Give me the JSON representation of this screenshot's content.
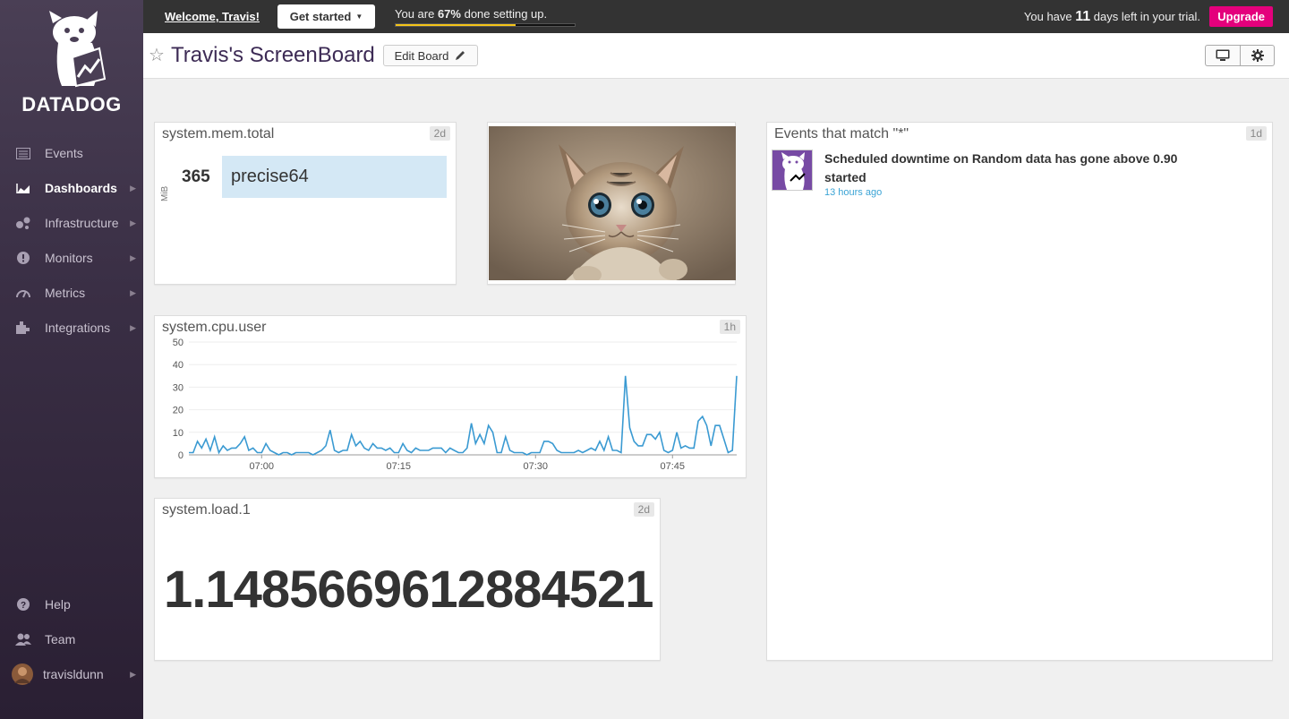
{
  "brand": {
    "name": "DATADOG"
  },
  "sidebar": {
    "items": [
      {
        "label": "Events",
        "icon": "events-icon"
      },
      {
        "label": "Dashboards",
        "icon": "dashboards-icon",
        "active": true
      },
      {
        "label": "Infrastructure",
        "icon": "infrastructure-icon"
      },
      {
        "label": "Monitors",
        "icon": "monitors-icon"
      },
      {
        "label": "Metrics",
        "icon": "metrics-icon"
      },
      {
        "label": "Integrations",
        "icon": "integrations-icon"
      }
    ],
    "bottom": [
      {
        "label": "Help",
        "icon": "help-icon"
      },
      {
        "label": "Team",
        "icon": "team-icon"
      },
      {
        "label": "travisldunn",
        "icon": "avatar"
      }
    ]
  },
  "topbar": {
    "welcome": "Welcome, Travis!",
    "get_started": "Get started",
    "progress_prefix": "You are ",
    "progress_percent": "67%",
    "progress_suffix": " done setting up.",
    "progress_value": 0.67,
    "trial_prefix": "You have ",
    "trial_days": "11",
    "trial_suffix": " days left in your trial.",
    "upgrade": "Upgrade",
    "colors": {
      "progress": "#f5c518",
      "upgrade": "#e4007c"
    }
  },
  "header": {
    "title": "Travis's ScreenBoard",
    "edit_button": "Edit Board"
  },
  "widgets": {
    "mem": {
      "title": "system.mem.total",
      "badge": "2d",
      "unit": "MiB",
      "value": "365",
      "host": "precise64"
    },
    "cpu": {
      "title": "system.cpu.user",
      "badge": "1h"
    },
    "load": {
      "title": "system.load.1",
      "badge": "2d",
      "value": "1.1485669612884521"
    },
    "events": {
      "title": "Events that match \"*\"",
      "badge": "1d",
      "items": [
        {
          "title": "Scheduled downtime on Random data has gone above 0.90 started",
          "time": "13 hours ago"
        }
      ]
    }
  },
  "chart_data": {
    "type": "line",
    "title": "system.cpu.user",
    "x_ticks": [
      "07:00",
      "07:15",
      "07:30",
      "07:45"
    ],
    "y_ticks": [
      0,
      10,
      20,
      30,
      40,
      50
    ],
    "ylim": [
      0,
      50
    ],
    "grid": true,
    "color": "#3a9ad2",
    "series": [
      {
        "values": [
          1,
          1,
          6,
          3,
          7,
          2,
          8,
          1,
          4,
          2,
          3,
          3,
          5,
          8,
          2,
          3,
          1,
          1,
          5,
          2,
          1,
          0,
          1,
          1,
          0,
          1,
          1,
          1,
          1,
          0,
          1,
          2,
          4,
          11,
          2,
          1,
          2,
          2,
          9,
          4,
          6,
          3,
          2,
          5,
          3,
          3,
          2,
          3,
          1,
          1,
          5,
          2,
          1,
          3,
          2,
          2,
          2,
          3,
          3,
          3,
          1,
          3,
          2,
          1,
          1,
          3,
          14,
          5,
          9,
          5,
          13,
          10,
          1,
          1,
          8,
          2,
          1,
          1,
          1,
          0,
          1,
          1,
          1,
          6,
          6,
          5,
          2,
          1,
          1,
          1,
          1,
          2,
          1,
          2,
          3,
          2,
          6,
          2,
          8,
          2,
          2,
          1,
          35,
          12,
          6,
          4,
          4,
          9,
          9,
          7,
          10,
          2,
          1,
          2,
          10,
          3,
          4,
          3,
          3,
          15,
          17,
          13,
          4,
          13,
          13,
          7,
          1,
          2,
          35
        ]
      }
    ]
  }
}
